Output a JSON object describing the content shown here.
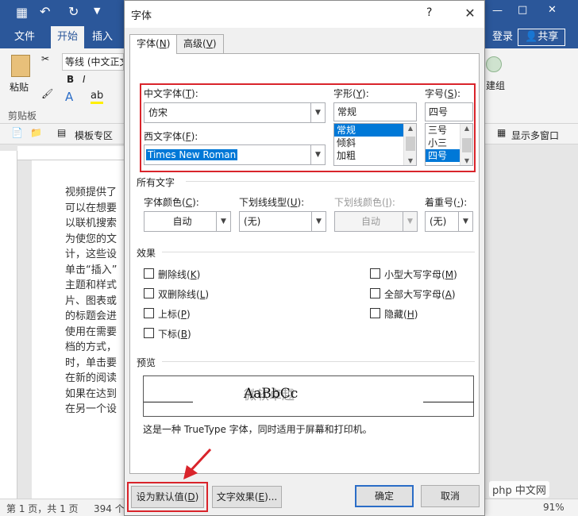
{
  "word": {
    "ribbon_tabs": [
      "文件",
      "开始",
      "插入"
    ],
    "right_login": "登录",
    "right_share": "共享",
    "font_box": "等线 (中文正文",
    "paste_label": "粘贴",
    "clipboard_label": "剪贴板",
    "template_zone": "模板专区",
    "multiwin": "显示多窗口",
    "build_label": "建组",
    "doc_lines": [
      "视频提供了",
      "可以在想要",
      "以联机搜索",
      "为使您的文",
      "计，这些设",
      "单击“插入”",
      "主题和样式",
      "片、图表或",
      "的标题会进",
      "使用在需要",
      "档的方式，",
      "时，单击要",
      "在新的阅读",
      "如果在达到",
      "在另一个设"
    ],
    "status_pages": "第 1 页，共 1 页",
    "status_words": "394 个",
    "zoom": "91%"
  },
  "dialog": {
    "title": "字体",
    "help": "?",
    "close": "✕",
    "tabs": [
      {
        "label": "字体",
        "key": "N"
      },
      {
        "label": "高级",
        "key": "V"
      }
    ],
    "cn_font_label": "中文字体",
    "cn_font_key": "T",
    "cn_font_value": "仿宋",
    "west_font_label": "西文字体",
    "west_font_key": "F",
    "west_font_value": "Times New Roman",
    "style_label": "字形",
    "style_key": "Y",
    "style_value": "常规",
    "style_options": [
      "常规",
      "倾斜",
      "加粗"
    ],
    "size_label": "字号",
    "size_key": "S",
    "size_value": "四号",
    "size_options": [
      "三号",
      "小三",
      "四号"
    ],
    "all_text_label": "所有文字",
    "font_color_label": "字体颜色",
    "font_color_key": "C",
    "font_color_value": "自动",
    "underline_label": "下划线线型",
    "underline_key": "U",
    "underline_value": "(无)",
    "underline_color_label": "下划线颜色",
    "underline_color_key": "I",
    "underline_color_value": "自动",
    "emphasis_label": "着重号",
    "emphasis_key": "·",
    "emphasis_value": "(无)",
    "effects_label": "效果",
    "effects_left": [
      {
        "label": "删除线",
        "key": "K"
      },
      {
        "label": "双删除线",
        "key": "L"
      },
      {
        "label": "上标",
        "key": "P"
      },
      {
        "label": "下标",
        "key": "B"
      }
    ],
    "effects_right": [
      {
        "label": "小型大写字母",
        "key": "M"
      },
      {
        "label": "全部大写字母",
        "key": "A"
      },
      {
        "label": "隐藏",
        "key": "H"
      }
    ],
    "preview_label": "预览",
    "preview_text": "AaBbCc",
    "preview_text_cn": "微软卓越",
    "truetype_note": "这是一种 TrueType 字体，同时适用于屏幕和打印机。",
    "btn_default": "设为默认值",
    "btn_default_key": "D",
    "btn_effects": "文字效果",
    "btn_effects_key": "E",
    "btn_ok": "确定",
    "btn_cancel": "取消"
  },
  "watermark": "php 中文网",
  "colors": {
    "word_blue": "#2b579a",
    "highlight_red": "#d9242b",
    "select_blue": "#0078d7"
  }
}
